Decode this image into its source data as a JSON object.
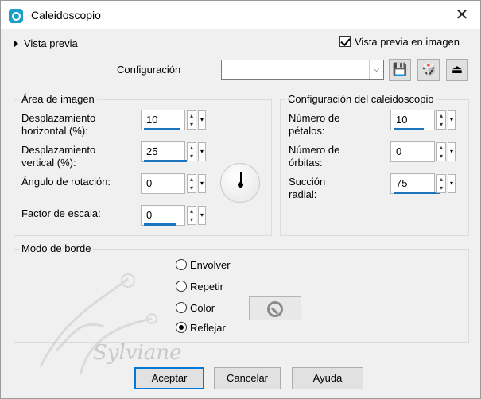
{
  "window": {
    "title": "Caleidoscopio",
    "close_glyph": "✕"
  },
  "preview": {
    "label": "Vista previa"
  },
  "live_preview": {
    "label": "Vista previa en imagen",
    "checked": true
  },
  "config": {
    "label": "Configuración",
    "value": "",
    "combo_arrow": "⌵"
  },
  "icons": {
    "save": "💾",
    "random": "🎲",
    "reset": "⏏"
  },
  "image_area": {
    "title": "Área de imagen",
    "h_offset": {
      "label_1": "Desplazamiento",
      "label_2": "horizontal (%):",
      "value": "10"
    },
    "v_offset": {
      "label_1": "Desplazamiento",
      "label_2": "vertical (%):",
      "value": "25"
    },
    "rotation": {
      "label": "Ángulo de rotación:",
      "value": "0"
    },
    "scale": {
      "label": "Factor de escala:",
      "value": "0"
    }
  },
  "kaleido_config": {
    "title": "Configuración del caleidoscopio",
    "petals": {
      "label_1": "Número de",
      "label_2": "pétalos:",
      "value": "10"
    },
    "orbits": {
      "label_1": "Número de",
      "label_2": "órbitas:",
      "value": "0"
    },
    "suction": {
      "label_1": "Succión",
      "label_2": "radial:",
      "value": "75"
    }
  },
  "border_mode": {
    "title": "Modo de borde",
    "options": [
      {
        "label": "Envolver",
        "selected": false
      },
      {
        "label": "Repetir",
        "selected": false
      },
      {
        "label": "Color",
        "selected": false
      },
      {
        "label": "Reflejar",
        "selected": true
      }
    ]
  },
  "watermark": {
    "text": "Sylviane"
  },
  "buttons": {
    "ok": "Aceptar",
    "cancel": "Cancelar",
    "help": "Ayuda"
  },
  "spin_glyphs": {
    "up": "▴",
    "down": "▾"
  }
}
